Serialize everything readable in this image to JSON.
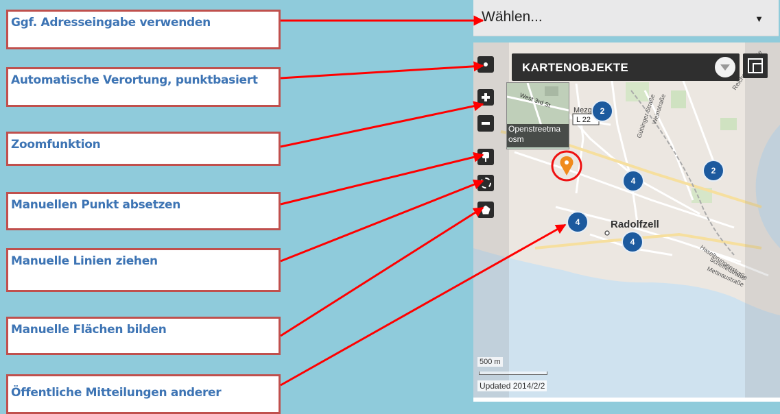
{
  "callouts": [
    "Ggf. Adresseingabe verwenden",
    "Automatische Verortung, punktbasiert",
    "Zoomfunktion",
    "Manuellen Punkt absetzen",
    "Manuelle Linien ziehen",
    "Manuelle Flächen bilden",
    "Öffentliche Mitteilungen anderer"
  ],
  "select": {
    "value": "Wählen...",
    "caret": "▼"
  },
  "map": {
    "layer_label": "KARTENOBJEKTE",
    "popup_caption_1": "Openstreetma",
    "popup_caption_2": "osm",
    "popup_street": "West 3rd St",
    "road_label": "L 22",
    "mezg_label": "Mezg",
    "city_label": "Radolfzell",
    "scale_label": "500 m",
    "updated_label": "Updated 2014/2/2",
    "streets": [
      "Güttinger Straße",
      "Weinstraße",
      "Reichenaustraße",
      "Haselbrunnenstraße",
      "Scheffelstraße",
      "Mettnaustraße"
    ],
    "clusters": [
      {
        "id": "c-a",
        "count": "2"
      },
      {
        "id": "c-b",
        "count": "4"
      },
      {
        "id": "c-c",
        "count": "2"
      },
      {
        "id": "c-d",
        "count": "4"
      },
      {
        "id": "c-e",
        "count": "4"
      }
    ],
    "colors": {
      "cluster": "#1c5a9e",
      "marker": "#f08a1c",
      "highlight": "#ff0000",
      "arrow": "#ff0000"
    }
  },
  "controls": [
    "locate-button",
    "zoom-in-button",
    "zoom-out-button",
    "draw-point-button",
    "draw-line-button",
    "draw-polygon-button"
  ]
}
